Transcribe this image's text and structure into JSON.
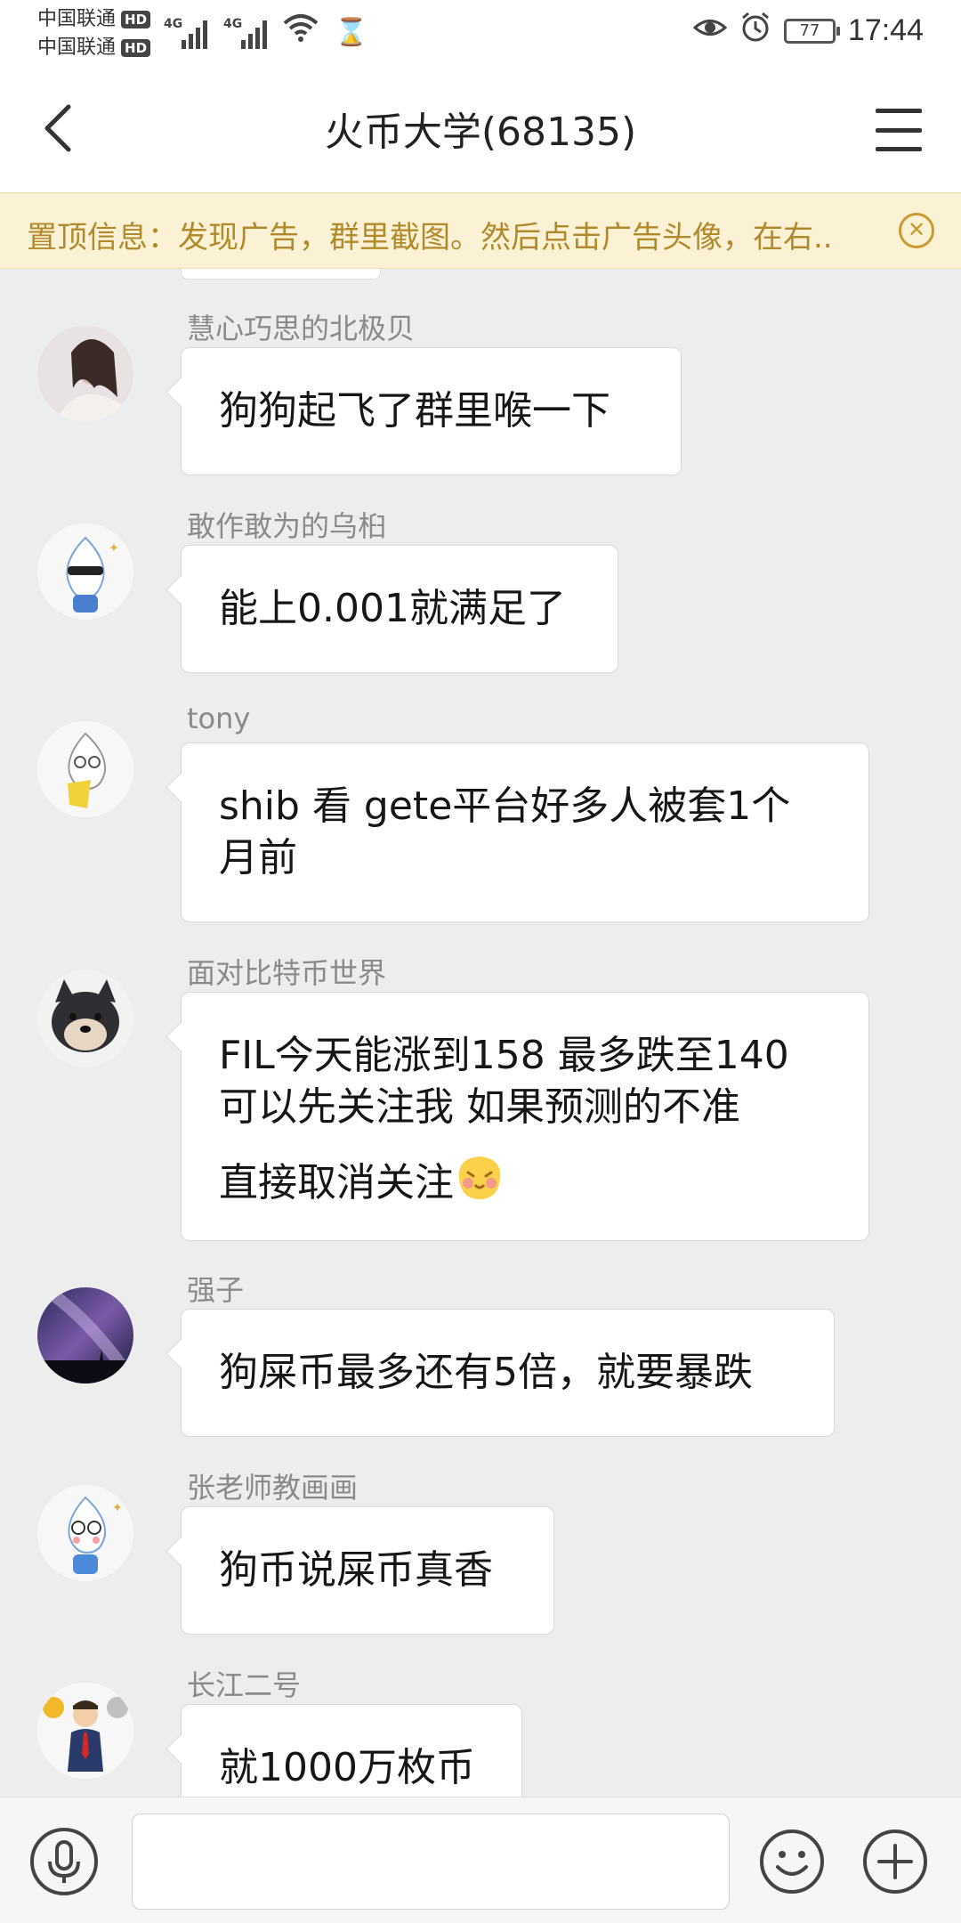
{
  "status_bar": {
    "carrier1": "中国联通",
    "carrier2": "中国联通",
    "hd_label": "HD",
    "network_type": "4G",
    "battery_level": "77",
    "time": "17:44",
    "icons": [
      "signal-icon",
      "wifi-icon",
      "hourglass-icon",
      "eye-icon",
      "alarm-icon",
      "battery-icon"
    ]
  },
  "header": {
    "title": "火币大学(68135)",
    "back_icon": "back-arrow-icon",
    "menu_icon": "menu-icon"
  },
  "pinned": {
    "text": "置顶信息：发现广告，群里截图。然后点击广告头像，在右..",
    "close_icon": "close-circle-icon"
  },
  "messages": [
    {
      "sender": "慧心巧思的北极贝",
      "text": "狗狗起飞了群里喉一下",
      "avatar": "woman-photo-avatar"
    },
    {
      "sender": "敢作敢为的乌桕",
      "text": "能上0.001就满足了",
      "avatar": "cartoon-sunglasses-avatar"
    },
    {
      "sender": "tony",
      "lines": [
        "shib 看 gete平台好多人被套1个",
        "月前"
      ],
      "avatar": "cartoon-yellow-avatar"
    },
    {
      "sender": "面对比特币世界",
      "lines": [
        "FIL今天能涨到158 最多跌至140",
        "可以先关注我  如果预测的不准",
        "直接取消关注"
      ],
      "emoji": "blush-face-emoji",
      "avatar": "shiba-dog-avatar"
    },
    {
      "sender": "强子",
      "text": "狗屎币最多还有5倍，就要暴跌",
      "avatar": "milky-way-avatar"
    },
    {
      "sender": "张老师教画画",
      "text": "狗币说屎币真香",
      "avatar": "cartoon-blue-avatar"
    },
    {
      "sender": "长江二号",
      "text": "就1000万枚币",
      "avatar": "businessman-coins-avatar"
    }
  ],
  "input_bar": {
    "voice_icon": "microphone-icon",
    "emoji_icon": "smiley-icon",
    "plus_icon": "plus-icon",
    "input_value": ""
  },
  "colors": {
    "chat_bg": "#ededed",
    "pinned_bg": "#fbf2d6",
    "pinned_text": "#b08a2a",
    "bubble_bg": "#ffffff",
    "sender_text": "#8a8a8a"
  }
}
